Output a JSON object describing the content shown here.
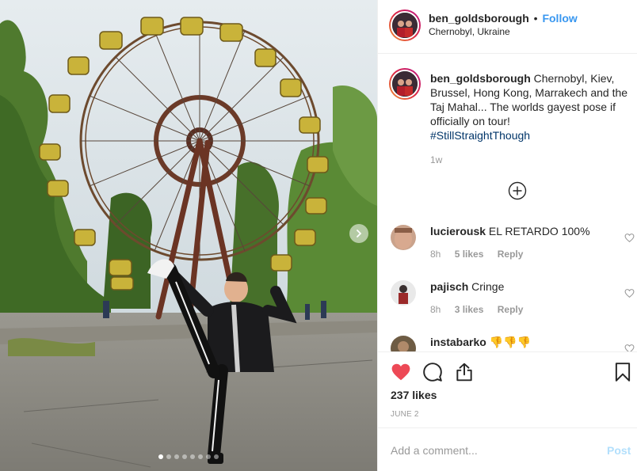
{
  "post": {
    "photo": {
      "carousel_dots": 8,
      "active_dot": 0
    },
    "header": {
      "username": "ben_goldsborough",
      "separator": "•",
      "follow_label": "Follow",
      "location": "Chernobyl, Ukraine"
    },
    "caption": {
      "username": "ben_goldsborough",
      "text": "Chernobyl, Kiev, Brussel, Hong Kong, Marrakech and the Taj Mahal... The worlds gayest pose if officially on tour!",
      "hashtag": "#StillStraightThough",
      "time": "1w"
    },
    "comments": [
      {
        "username": "lucierousk",
        "text": "EL RETARDO 100%",
        "time": "8h",
        "likes": "5 likes",
        "reply": "Reply"
      },
      {
        "username": "pajisch",
        "text": "Cringe",
        "time": "8h",
        "likes": "3 likes",
        "reply": "Reply"
      },
      {
        "username": "instabarko",
        "text": "👎👎👎",
        "time": "",
        "likes": "",
        "reply": ""
      }
    ],
    "likes": "237 likes",
    "liked": true,
    "date": "JUNE 2",
    "add_comment_placeholder": "Add a comment...",
    "post_label": "Post",
    "icons": [
      "heart-filled-icon",
      "comment-icon",
      "share-icon",
      "bookmark-icon",
      "plus-circle-icon",
      "chevron-right-icon",
      "heart-outline-icon"
    ],
    "colors": {
      "accent": "#3897f0",
      "like": "#ed4956",
      "post_disabled": "#b2dffc",
      "muted": "#999999"
    }
  }
}
